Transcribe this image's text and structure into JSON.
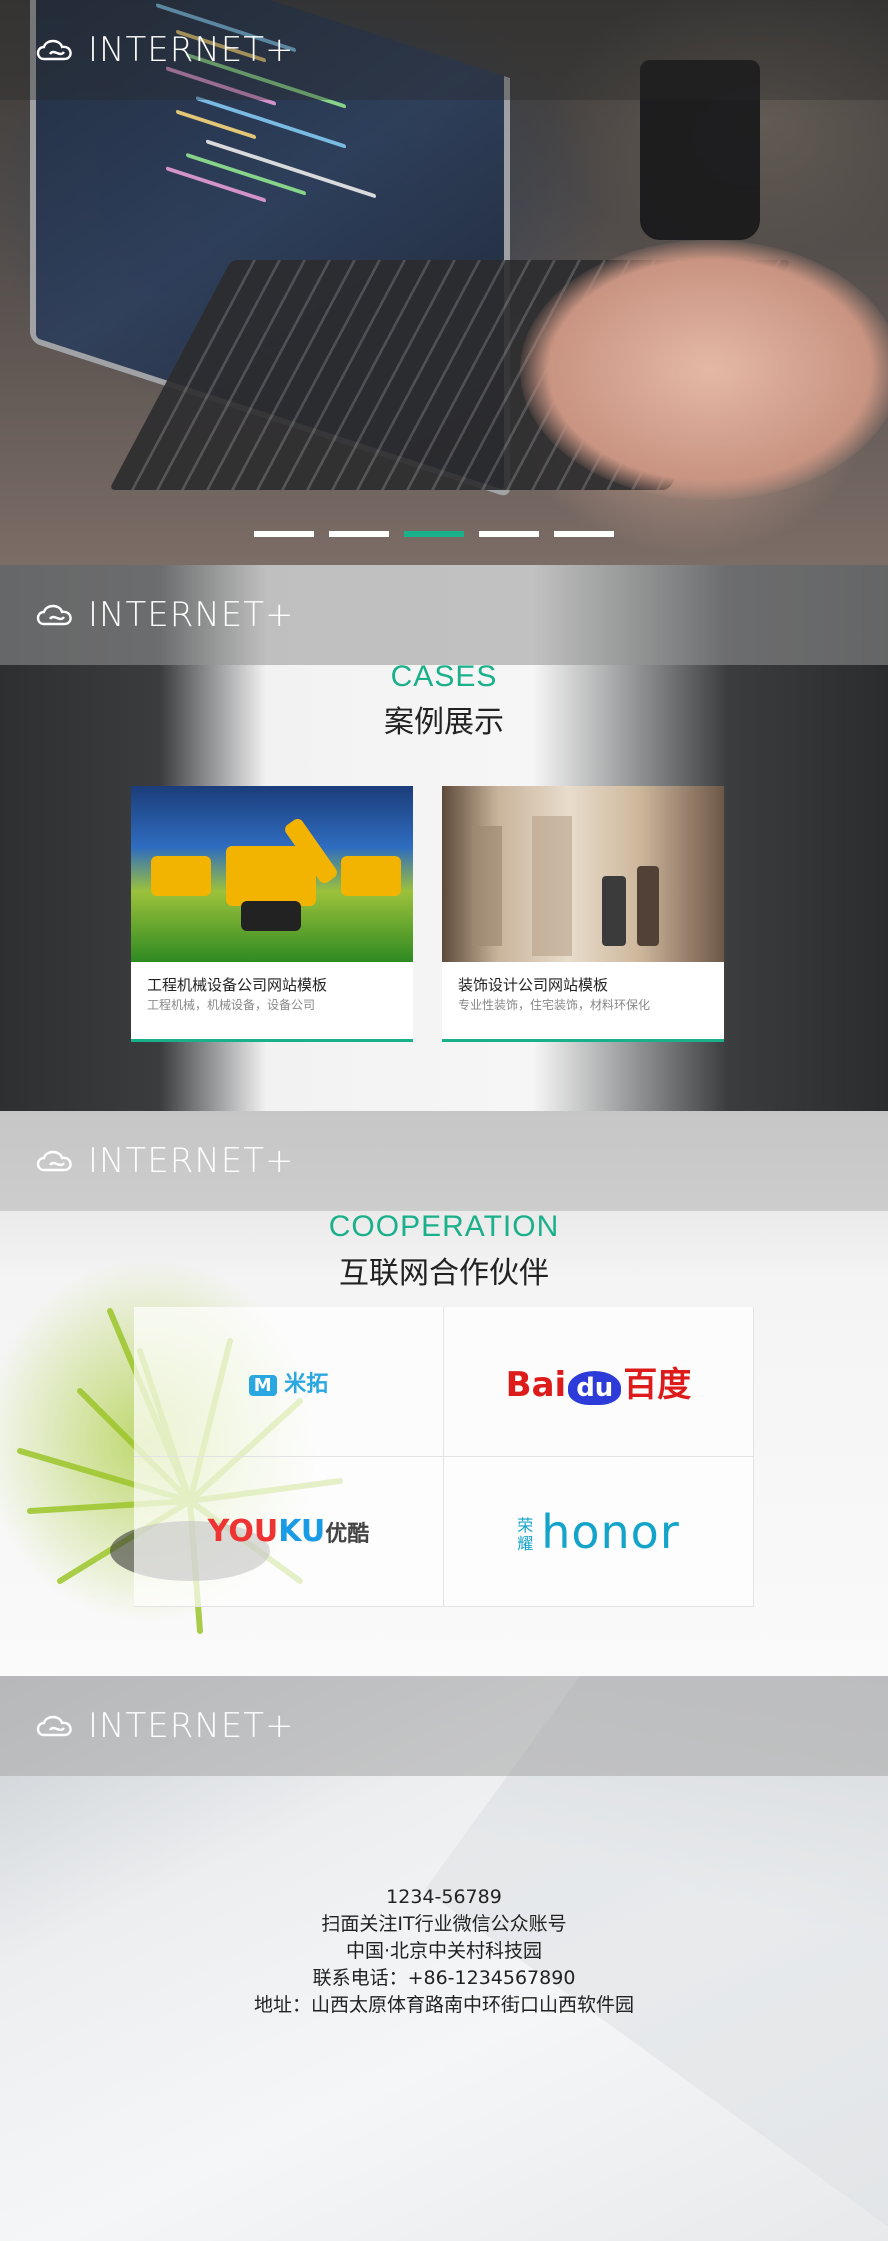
{
  "brand": {
    "logo_text": "INTERNET+",
    "accent_color": "#19b08a"
  },
  "hero": {
    "slide_count": 5,
    "active_slide": 3
  },
  "cases": {
    "title_en": "CASES",
    "title_cn": "案例展示",
    "items": [
      {
        "title": "工程机械设备公司网站模板",
        "subtitle": "工程机械，机械设备，设备公司"
      },
      {
        "title": "装饰设计公司网站模板",
        "subtitle": "专业性装饰，住宅装饰，材料环保化"
      }
    ]
  },
  "cooperation": {
    "title_en": "COOPERATION",
    "title_cn": "互联网合作伙伴",
    "partners": [
      {
        "name": "米拓",
        "icon": "mituo-logo"
      },
      {
        "name": "Bai du 百度",
        "icon": "baidu-logo"
      },
      {
        "name": "YOUKU 优酷",
        "icon": "youku-logo"
      },
      {
        "name": "荣耀 honor",
        "icon": "honor-logo"
      }
    ]
  },
  "footer": {
    "lines": [
      "1234-56789",
      "扫面关注IT行业微信公众账号",
      "中国·北京中关村科技园",
      "联系电话：+86-1234567890",
      "地址：山西太原体育路南中环街口山西软件园"
    ]
  }
}
